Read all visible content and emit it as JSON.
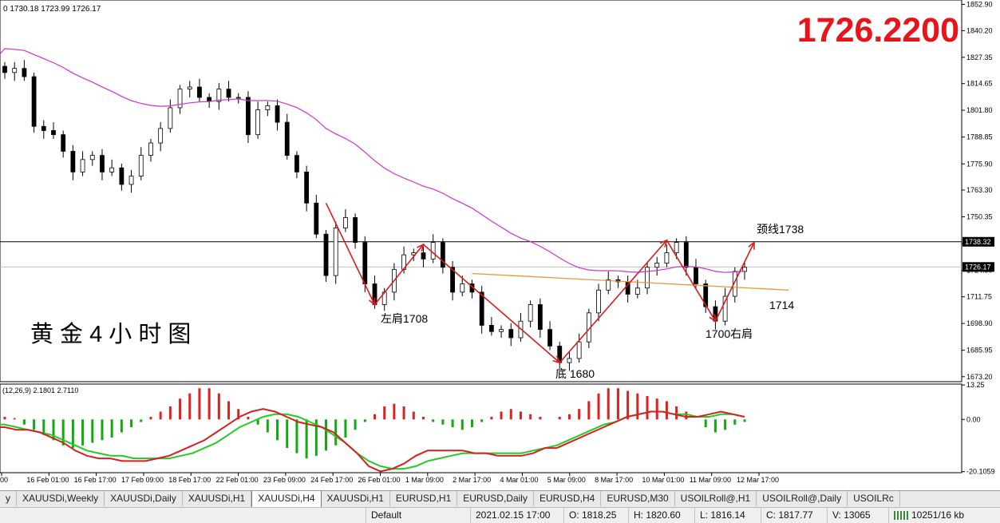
{
  "window": {
    "ohlc_header": "0 1730.18 1723.99 1726.17"
  },
  "price_display": "1726.2200",
  "chart_title": "黄 金 4 小 时 图",
  "indicator_header": "(12,26,9) 2.1801 2.7110",
  "annotations": {
    "neckline": "颈线1738",
    "left_shoulder": "左肩1708",
    "bottom": "底 1680",
    "right_shoulder": "1700右肩",
    "level_1714": "1714"
  },
  "chart_data": {
    "type": "candlestick",
    "symbol": "XAUUSDi",
    "timeframe": "H4",
    "y_ticks": [
      "1852.90",
      "1840.20",
      "1827.35",
      "1814.65",
      "1801.80",
      "1788.85",
      "1775.90",
      "1763.30",
      "1750.35",
      "1737.35",
      "1724.50",
      "1711.75",
      "1698.90",
      "1685.95",
      "1673.20"
    ],
    "y_range": [
      1670.8,
      1855.0
    ],
    "current_price_label": "1726.17",
    "hline_label": "1738.32",
    "macd_ticks": [
      "13.25",
      "0.00",
      "-20.1059"
    ],
    "macd_range": [
      -20.5,
      13.6
    ],
    "x_ticks": [
      "00",
      "16 Feb 01:00",
      "16 Feb 17:00",
      "17 Feb 09:00",
      "18 Feb 17:00",
      "22 Feb 01:00",
      "23 Feb 09:00",
      "24 Feb 17:00",
      "26 Feb 01:00",
      "1 Mar 09:00",
      "2 Mar 17:00",
      "4 Mar 01:00",
      "5 Mar 09:00",
      "8 Mar 17:00",
      "10 Mar 01:00",
      "11 Mar 09:00",
      "12 Mar 17:00"
    ],
    "close_path": [
      1820,
      1822,
      1818,
      1794,
      1792,
      1790,
      1782,
      1772,
      1778,
      1780,
      1772,
      1774,
      1766,
      1770,
      1780,
      1786,
      1793,
      1803,
      1812,
      1813,
      1808,
      1806,
      1812,
      1808,
      1808,
      1790,
      1802,
      1804,
      1796,
      1780,
      1772,
      1757,
      1742,
      1722,
      1745,
      1750,
      1738,
      1718,
      1708,
      1714,
      1725,
      1732,
      1733,
      1730,
      1738,
      1726,
      1714,
      1718,
      1714,
      1698,
      1695,
      1696,
      1692,
      1700,
      1708,
      1696,
      1688,
      1680,
      1682,
      1690,
      1704,
      1715,
      1720,
      1719,
      1713,
      1716,
      1726,
      1728,
      1733,
      1738,
      1726,
      1718,
      1707,
      1700,
      1712,
      1724,
      1726
    ],
    "macd_hist": [
      1,
      0.5,
      -2,
      -4,
      -6,
      -8,
      -10,
      -11,
      -10,
      -9,
      -8,
      -7,
      -5,
      -3,
      -1,
      1,
      3,
      5,
      8,
      10,
      12,
      12,
      10,
      7,
      4,
      1,
      -2,
      -5,
      -8,
      -11,
      -13,
      -15,
      -14,
      -12,
      -10,
      -7,
      -4,
      -1,
      2,
      5,
      6,
      5,
      3,
      1,
      -1,
      -2,
      -3,
      -4,
      -3,
      -1,
      1,
      3,
      4,
      3,
      2,
      1,
      0,
      1,
      2,
      4,
      7,
      10,
      12,
      12,
      11,
      10,
      9,
      8,
      7,
      5,
      3,
      0,
      -3,
      -5,
      -4,
      -2,
      -1
    ],
    "macd_line": [
      -3,
      -4,
      -4,
      -5,
      -7,
      -9,
      -12,
      -14,
      -15,
      -15,
      -16,
      -16,
      -16,
      -15,
      -14,
      -12,
      -10,
      -8,
      -5,
      -2,
      1,
      3,
      4,
      3,
      1,
      -1,
      -2,
      -3,
      -5,
      -9,
      -13,
      -18,
      -20,
      -19,
      -17,
      -14,
      -12,
      -12,
      -12,
      -12,
      -13,
      -13,
      -14,
      -14,
      -14,
      -13,
      -11,
      -11,
      -9,
      -7,
      -5,
      -3,
      -1,
      1,
      2,
      3,
      3,
      2,
      1,
      1,
      2,
      3,
      2,
      1
    ],
    "signal_line": [
      -2,
      -3,
      -4,
      -5,
      -6,
      -8,
      -10,
      -12,
      -13,
      -14,
      -14,
      -15,
      -15,
      -15,
      -15,
      -14,
      -13,
      -11,
      -9,
      -6,
      -3,
      -1,
      1,
      2,
      2,
      1,
      -1,
      -3,
      -6,
      -9,
      -13,
      -16,
      -18,
      -19,
      -19,
      -18,
      -16,
      -15,
      -14,
      -13,
      -13,
      -13,
      -13,
      -13,
      -13,
      -12,
      -11,
      -10,
      -8,
      -6,
      -4,
      -2,
      -1,
      1,
      2,
      3,
      3,
      2,
      2,
      1,
      1,
      2,
      2,
      1
    ]
  },
  "tabs": [
    {
      "label": "y",
      "active": false
    },
    {
      "label": "XAUUSDi,Weekly",
      "active": false
    },
    {
      "label": "XAUUSDi,Daily",
      "active": false
    },
    {
      "label": "XAUUSDi,H1",
      "active": false
    },
    {
      "label": "XAUUSDi,H4",
      "active": true
    },
    {
      "label": "XAUUSDi,H1",
      "active": false
    },
    {
      "label": "EURUSD,H1",
      "active": false
    },
    {
      "label": "EURUSD,Daily",
      "active": false
    },
    {
      "label": "EURUSD,H4",
      "active": false
    },
    {
      "label": "EURUSD,M30",
      "active": false
    },
    {
      "label": "USOILRoll@,H1",
      "active": false
    },
    {
      "label": "USOILRoll@,Daily",
      "active": false
    },
    {
      "label": "USOILRc",
      "active": false
    }
  ],
  "status": {
    "profile": "Default",
    "datetime": "2021.02.15 17:00",
    "open": "O: 1818.25",
    "high": "H: 1820.60",
    "low": "L: 1816.14",
    "close": "C: 1817.77",
    "volume": "V: 13065",
    "traffic": "10251/16 kb"
  },
  "colors": {
    "bull": "#ffffff",
    "bear": "#000000",
    "ma": "#cc33cc",
    "trendline": "#e89a3c",
    "annotation": "#d81b1b",
    "macd_pos": "#dd2222",
    "macd_neg": "#11aa11",
    "macd_line": "#d42020",
    "signal_line": "#22cc22",
    "price_text": "#e8141b"
  }
}
